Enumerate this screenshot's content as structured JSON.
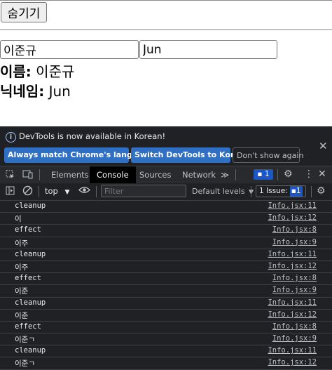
{
  "page": {
    "hide_button": "숨기기",
    "name_input_value": "이준규",
    "nickname_input_value": "Jun",
    "name_label": "이름:",
    "name_value": "이준규",
    "nickname_label": "닉네임:",
    "nickname_value": "Jun"
  },
  "devtools": {
    "banner": {
      "message": "DevTools is now available in Korean!",
      "btn_match_language": "Always match Chrome's language",
      "btn_switch_korean": "Switch DevTools to Korean",
      "btn_dont_show": "Don't show again"
    },
    "tabs": [
      "Elements",
      "Console",
      "Sources",
      "Network"
    ],
    "active_tab": "Console",
    "more_tabs": "≫",
    "issue_badge_count": "1",
    "console": {
      "context": "top",
      "filter_placeholder": "Filter",
      "levels": "Default levels",
      "issues_label": "1 Issue:",
      "issues_count": "1"
    },
    "log": [
      {
        "text": "cleanup",
        "source": "Info.jsx:11"
      },
      {
        "text": "이",
        "source": "Info.jsx:12"
      },
      {
        "text": "effect",
        "source": "Info.jsx:8"
      },
      {
        "text": "이주",
        "source": "Info.jsx:9"
      },
      {
        "text": "cleanup",
        "source": "Info.jsx:11"
      },
      {
        "text": "이주",
        "source": "Info.jsx:12"
      },
      {
        "text": "effect",
        "source": "Info.jsx:8"
      },
      {
        "text": "이준",
        "source": "Info.jsx:9"
      },
      {
        "text": "cleanup",
        "source": "Info.jsx:11"
      },
      {
        "text": "이준",
        "source": "Info.jsx:12"
      },
      {
        "text": "effect",
        "source": "Info.jsx:8"
      },
      {
        "text": "이준ㄱ",
        "source": "Info.jsx:9"
      },
      {
        "text": "cleanup",
        "source": "Info.jsx:11"
      },
      {
        "text": "이준ㄱ",
        "source": "Info.jsx:12"
      }
    ]
  }
}
